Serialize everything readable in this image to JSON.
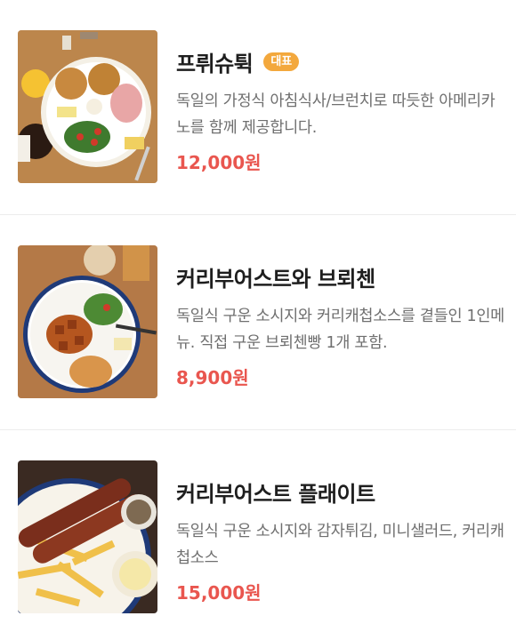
{
  "menu": {
    "items": [
      {
        "title": "프뤼슈튁",
        "badge": "대표",
        "description": "독일의 가정식 아침식사/브런치로 따듯한 아메리카노를 함께 제공합니다.",
        "price": "12,000원",
        "image": "breakfast-plate-photo"
      },
      {
        "title": "커리부어스트와 브뢰첸",
        "badge": "",
        "description": "독일식 구운 소시지와 커리캐첩소스를 곁들인 1인메뉴. 직접 구운 브뢰첸빵 1개 포함.",
        "price": "8,900원",
        "image": "currywurst-bread-photo"
      },
      {
        "title": "커리부어스트 플래이트",
        "badge": "",
        "description": "독일식 구운 소시지와 감자튀김, 미니샐러드, 커리캐첩소스",
        "price": "15,000원",
        "image": "currywurst-fries-photo"
      }
    ]
  },
  "colors": {
    "badge": "#f3a83d",
    "price": "#e9564f",
    "divider": "#ececec"
  }
}
